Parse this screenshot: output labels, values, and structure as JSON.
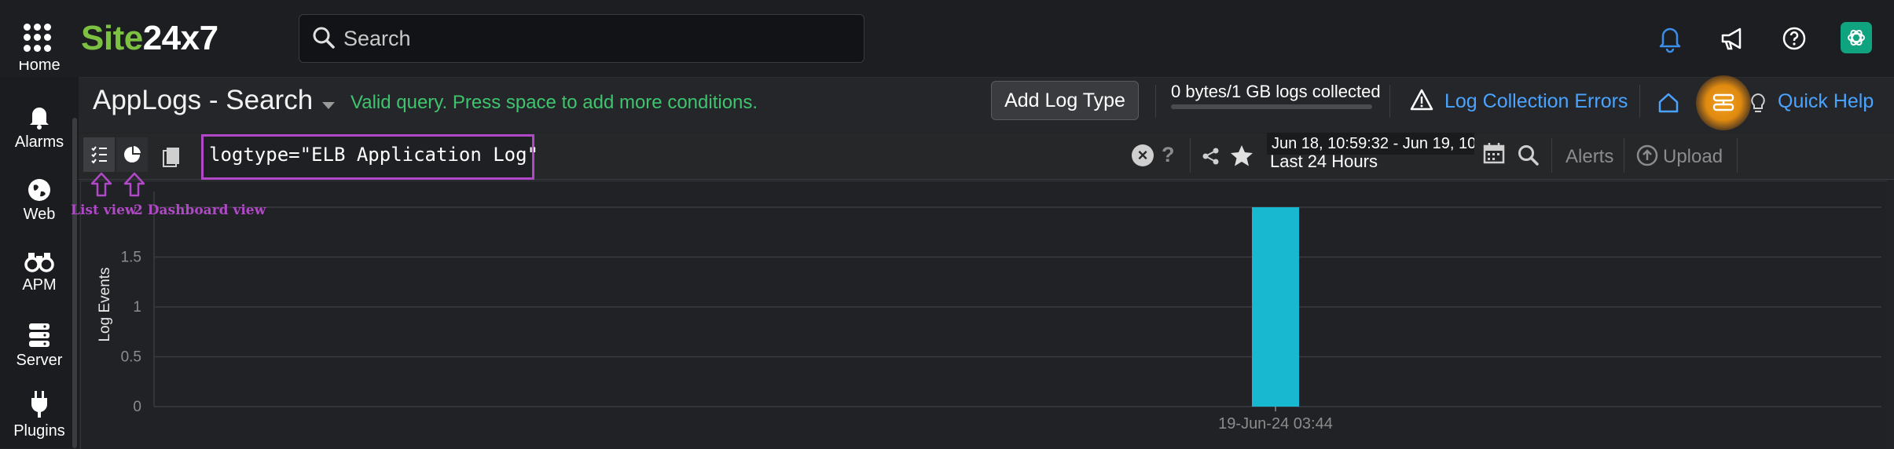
{
  "topbar": {
    "logo_site": "Site",
    "logo_num": "24x7",
    "search_placeholder": "Search",
    "icons": [
      "apps-grid-icon",
      "bell-icon",
      "megaphone-icon",
      "help-icon",
      "chatgpt-icon"
    ]
  },
  "leftnav": {
    "items": [
      {
        "label": "Home",
        "icon": "home-icon"
      },
      {
        "label": "Alarms",
        "icon": "bell-icon"
      },
      {
        "label": "Web",
        "icon": "globe-icon"
      },
      {
        "label": "APM",
        "icon": "binoculars-icon"
      },
      {
        "label": "Server",
        "icon": "server-icon"
      },
      {
        "label": "Plugins",
        "icon": "plug-icon"
      }
    ]
  },
  "header": {
    "title": "AppLogs - Search",
    "valid_message": "Valid query. Press space to add more conditions.",
    "add_log_type": "Add Log Type",
    "logs_collected": "0 bytes/1 GB logs collected",
    "logs_collected_fraction": 0.0,
    "log_collection_errors": "Log Collection Errors",
    "quick_help": "Quick Help",
    "accent": "#4aa3ff",
    "valid_color": "#3ec46d"
  },
  "query": {
    "text": "logtype=\"ELB Application Log\"",
    "help": "?",
    "date_range": "Jun 18, 10:59:32 - Jun 19, 10:...",
    "date_preset": "Last 24 Hours",
    "alerts": "Alerts",
    "upload": "Upload"
  },
  "annotations": {
    "list_view": "List view",
    "dashboard_view": "2 Dashboard view",
    "color": "#b048c8"
  },
  "chart_data": {
    "type": "bar",
    "ylabel": "Log Events",
    "yticks": [
      "0",
      "0.5",
      "1",
      "1.5"
    ],
    "ylim": [
      0,
      2
    ],
    "categories": [
      "19-Jun-24 03:44"
    ],
    "values": [
      2
    ],
    "color": "#17b8d0",
    "grid": true
  }
}
